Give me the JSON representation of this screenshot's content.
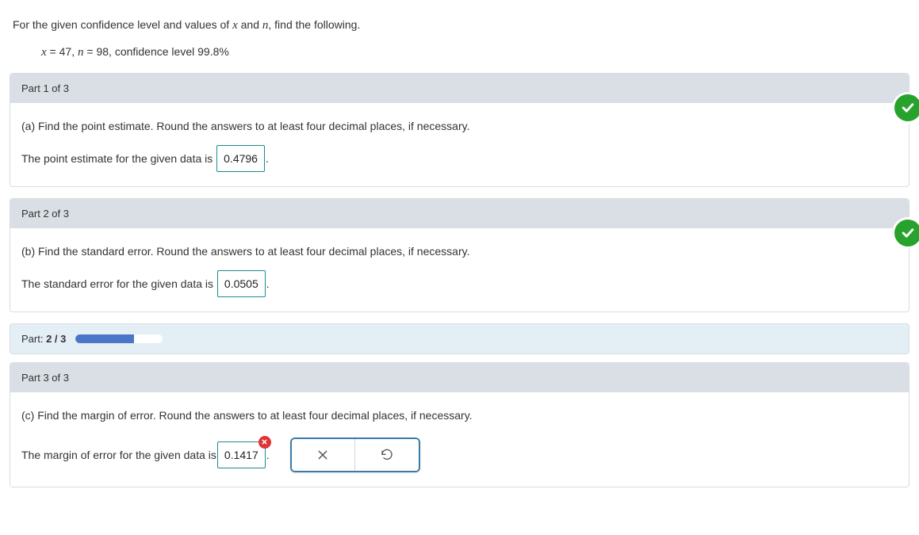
{
  "intro": {
    "text_prefix": "For the given confidence level and values of ",
    "var1": "x",
    "text_mid1": " and ",
    "var2": "n",
    "text_suffix": ", find the following.",
    "given_prefix": "x",
    "given_sep1": " = ",
    "x_value": "47",
    "given_comma": ", ",
    "given_n": "n",
    "given_sep2": " = ",
    "n_value": "98",
    "conf_text": ", confidence level ",
    "conf_value": "99.8%"
  },
  "part1": {
    "header": "Part 1 of 3",
    "prompt": "(a) Find the point estimate. Round the answers to at least four decimal places, if necessary.",
    "sentence_before": "The point estimate for the given data is ",
    "answer": "0.4796",
    "sentence_after": "."
  },
  "part2": {
    "header": "Part 2 of 3",
    "prompt": "(b) Find the standard error. Round the answers to at least four decimal places, if necessary.",
    "sentence_before": "The standard error for the given data is ",
    "answer": "0.0505",
    "sentence_after": "."
  },
  "progress": {
    "label_prefix": "Part: ",
    "current": "2",
    "sep": " / ",
    "total": "3",
    "percent": 66.6
  },
  "part3": {
    "header": "Part 3 of 3",
    "prompt": "(c) Find the margin of error. Round the answers to at least four decimal places, if necessary.",
    "sentence_before": "The margin of error for the given data is ",
    "answer": "0.1417",
    "sentence_after": "."
  }
}
